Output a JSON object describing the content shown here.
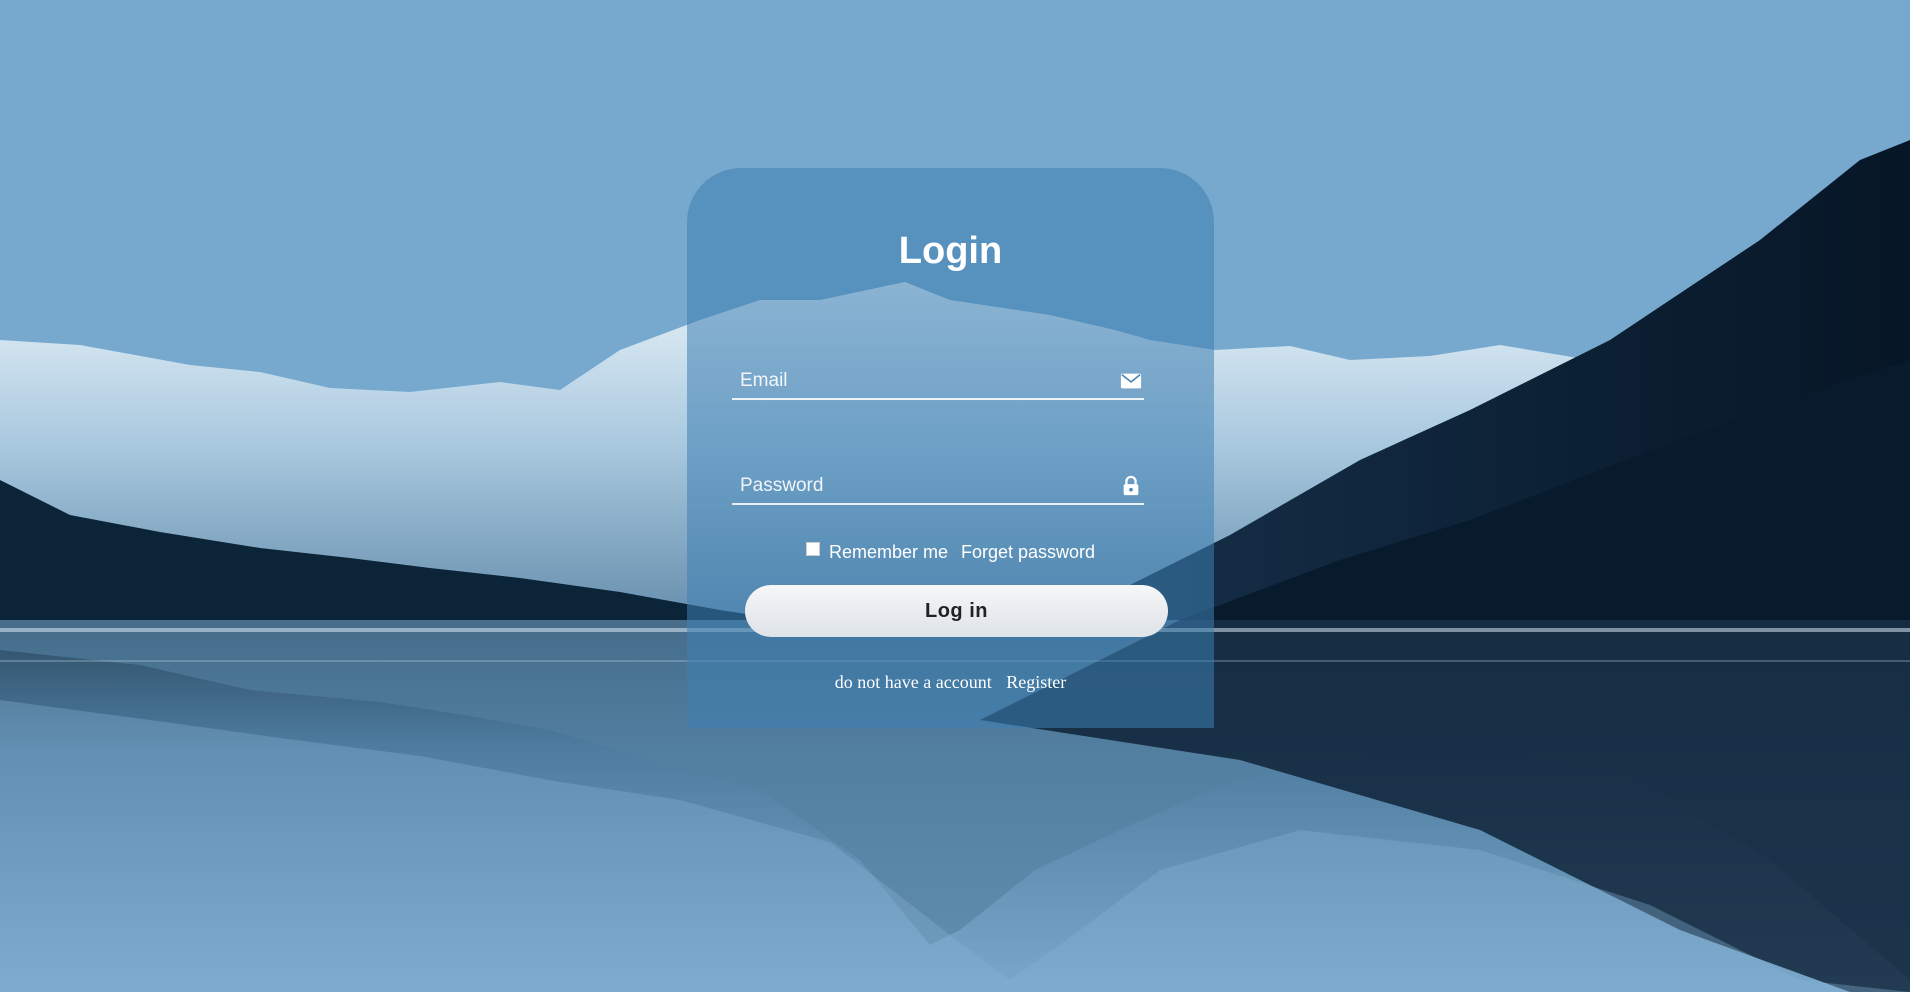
{
  "login": {
    "title": "Login",
    "email": {
      "placeholder": "Email",
      "value": ""
    },
    "password": {
      "placeholder": "Password",
      "value": ""
    },
    "remember_label": "Remember me",
    "remember_checked": false,
    "forget_label": "Forget password",
    "login_button_label": "Log in",
    "no_account_text": "do not have a account",
    "register_label": "Register"
  },
  "icons": {
    "email": "envelope-icon",
    "password": "lock-icon"
  },
  "colors": {
    "card_overlay": "#3e80b3",
    "button_background": "#f6f7f8",
    "text": "#ffffff"
  }
}
